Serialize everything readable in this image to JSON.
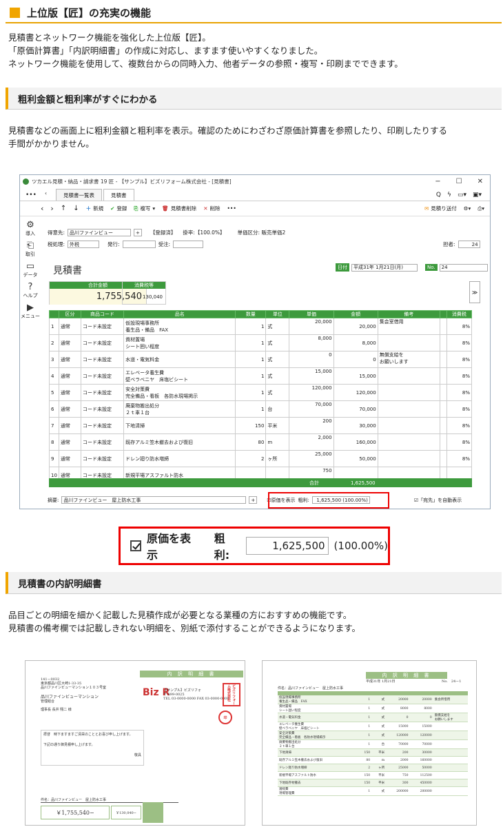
{
  "section1": {
    "title": "上位版【匠】の充実の機能",
    "lines": [
      "見積書とネットワーク機能を強化した上位版【匠】。",
      "「原価計算書」「内訳明細書」の作成に対応し、ますます使いやすくなりました。",
      "ネットワーク機能を使用して、複数台からの同時入力、他者データの参照・複写・印刷までできます。"
    ]
  },
  "section2": {
    "title": "粗利金額と粗利率がすぐにわかる",
    "lines": [
      "見積書などの画面上に粗利金額と粗利率を表示。確認のためにわざわざ原価計算書を参照したり、印刷したりする",
      "手間がかかりません。"
    ]
  },
  "app": {
    "window_title": "ツカエル見積・納品・請求書 19 匠 - 【サンプル】ビズリフォーム株式会社 - [見積書]",
    "tabs": [
      "見積書一覧表",
      "見積書"
    ],
    "toolbar": {
      "new": "新規",
      "register": "登録",
      "copy": "複写",
      "delete_quote": "見積書削除",
      "delete": "削除",
      "more": "•••",
      "send": "見積り送付"
    },
    "side": [
      "導入",
      "取引",
      "データ",
      "ヘルプ",
      "メニュー"
    ],
    "form": {
      "customer_label": "得意先:",
      "customer": "品川ファインビュー",
      "registered": "【登録済】",
      "rate": "掛率:【100.0%】",
      "price_class": "単価区分: 販売単価2",
      "tax_label": "税処理:",
      "tax": "外税",
      "issue_label": "発行:",
      "order_label": "受注:",
      "staff_label": "担者:",
      "staff": "24"
    },
    "doc_title": "見積書",
    "date_label": "日付",
    "date": "平成31年 1月21日(月)",
    "no_label": "No.",
    "no": "24",
    "total_label": "合計金額",
    "total": "1,755,540",
    "tax_amount_label": "消費税等",
    "tax_amount": "130,040",
    "columns": [
      "区分",
      "商品コード",
      "品名",
      "数量",
      "単位",
      "単価",
      "金額",
      "備考",
      "",
      "消費税"
    ],
    "rows": [
      {
        "n": "1",
        "k": "通常",
        "c": "コード未設定",
        "name": "仮設現場事務所\n養生品・備品　FAX",
        "q": "1",
        "u": "式",
        "p": "20,000",
        "a": "20,000",
        "note": "集会室借用",
        "t": "8%"
      },
      {
        "n": "2",
        "k": "通常",
        "c": "コード未設定",
        "name": "資材置場\nシート囲い程度",
        "q": "1",
        "u": "式",
        "p": "8,000",
        "a": "8,000",
        "note": "",
        "t": "8%"
      },
      {
        "n": "3",
        "k": "通常",
        "c": "コード未設定",
        "name": "水道・電気料金",
        "q": "1",
        "u": "式",
        "p": "0",
        "a": "0",
        "note": "無償支給を\nお願いします",
        "t": "8%"
      },
      {
        "n": "4",
        "k": "通常",
        "c": "コード未設定",
        "name": "エレベータ養生費\n壁ベラベニヤ　床塩ビシート",
        "q": "1",
        "u": "式",
        "p": "15,000",
        "a": "15,000",
        "note": "",
        "t": "8%"
      },
      {
        "n": "5",
        "k": "通常",
        "c": "コード未設定",
        "name": "安全対策費\n完全備品・看板　各防水現場掲示",
        "q": "1",
        "u": "式",
        "p": "120,000",
        "a": "120,000",
        "note": "",
        "t": "8%"
      },
      {
        "n": "6",
        "k": "通常",
        "c": "コード未設定",
        "name": "廃棄物搬出処分\n２ｔ車１台",
        "q": "1",
        "u": "台",
        "p": "70,000",
        "a": "70,000",
        "note": "",
        "t": "8%"
      },
      {
        "n": "7",
        "k": "通常",
        "c": "コード未設定",
        "name": "下地清掃",
        "q": "150",
        "u": "平米",
        "p": "200",
        "a": "30,000",
        "note": "",
        "t": "8%"
      },
      {
        "n": "8",
        "k": "通常",
        "c": "コード未設定",
        "name": "既存アルミ笠木撤去および復旧",
        "q": "80",
        "u": "m",
        "p": "2,000",
        "a": "160,000",
        "note": "",
        "t": "8%"
      },
      {
        "n": "9",
        "k": "通常",
        "c": "コード未設定",
        "name": "ドレン廻り防水増締",
        "q": "2",
        "u": "ヶ所",
        "p": "25,000",
        "a": "50,000",
        "note": "",
        "t": "8%"
      },
      {
        "n": "10",
        "k": "通常",
        "c": "コード未設定",
        "name": "新規平場アスファルト防水",
        "q": "",
        "u": "",
        "p": "750",
        "a": "",
        "note": "",
        "t": ""
      }
    ],
    "sum_label": "合計",
    "sum": "1,625,500",
    "summary_label": "摘要:",
    "summary": "品川ファインビュー　屋上防水工事",
    "show_cost": "原価を表示",
    "gross_label": "粗利:",
    "gross": "1,625,500 (100.00%)",
    "auto_dest": "「宛先」を自動表示"
  },
  "zoom": {
    "show_cost": "原価を表示",
    "gross_label": "粗利:",
    "gross_value": "1,625,500",
    "gross_pct": "(100.00%)"
  },
  "section3": {
    "title": "見積書の内訳明細書",
    "lines": [
      "品目ごとの明細を細かく記載した見積作成が必要となる業種の方におすすめの機能です。",
      "見積書の備考欄では記載しきれない明細を、別紙で添付することができるようになります。"
    ]
  },
  "doc1": {
    "title": "内 訳 明 細 書",
    "zip": "141－0032",
    "addr": "東京都品川区大崎1-33-35",
    "bldg": "品川ファインビューマンション１０３号室",
    "customer": "品川ファインビューマンション",
    "dept": "管理組合",
    "person": "理事長 長井 翔二 様",
    "company": "【サンプル】ビズリフォ",
    "zip2": "〒 899-0025",
    "tel": "TEL 03-0000-0000 FAX 03-0000-0000",
    "note1": "拝啓　時下ますますご清栄のこととお喜び申し上げます。",
    "note2": "下記の通り御見積申し上げます。",
    "keigu": "敬具",
    "case": "件名：品川ファインビュー　屋上防水工事",
    "total": "￥1,755,540−",
    "tax": "￥130,040−",
    "stamp": "ビズ 株式会社 リフォーム"
  },
  "doc2": {
    "title": "内 訳 明 細 書",
    "date": "平成31年 1月21日",
    "no": "No.　24－1",
    "case": "件名：品川ファインビュー　屋上防水工事",
    "rows": [
      [
        "仮設現場事務所\n養生品・備品　FAX",
        "1",
        "式",
        "20000",
        "20000",
        "集会所借用"
      ],
      [
        "資材置場\nシート囲い程度",
        "1",
        "式",
        "8000",
        "8000",
        ""
      ],
      [
        "水道・電気料金",
        "1",
        "式",
        "0",
        "0",
        "無償支給を\nお願いします"
      ],
      [
        "エレベータ養生費\n壁ベラベニヤ　床塩ビシート",
        "1",
        "式",
        "15000",
        "15000",
        ""
      ],
      [
        "安全対策費\n完全備品・看板　各防水現場掲示",
        "1",
        "式",
        "120000",
        "120000",
        ""
      ],
      [
        "廃棄物搬出処分\n２ｔ車１台",
        "1",
        "台",
        "70000",
        "70000",
        ""
      ],
      [
        "下地清掃",
        "150",
        "平米",
        "200",
        "30000",
        ""
      ],
      [
        "既存アルミ笠木撤去および復旧",
        "80",
        "m",
        "2000",
        "160000",
        ""
      ],
      [
        "ドレン廻り防水増締",
        "2",
        "ヶ所",
        "25000",
        "50000",
        ""
      ],
      [
        "新規平場アスファルト防水",
        "150",
        "平米",
        "750",
        "112500",
        ""
      ],
      [
        "下地既存材撤去",
        "150",
        "平米",
        "300",
        "450000",
        ""
      ],
      [
        "諸経費\n現場管理費",
        "1",
        "式",
        "200000",
        "200000",
        ""
      ]
    ]
  }
}
